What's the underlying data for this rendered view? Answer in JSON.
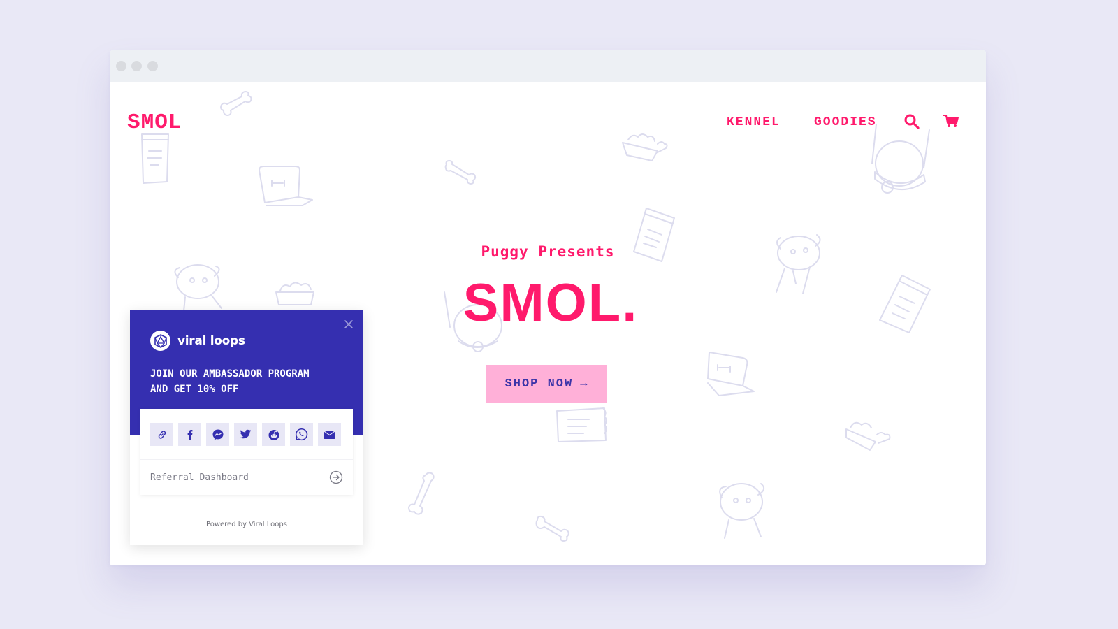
{
  "window": {
    "controls": [
      "close",
      "minimize",
      "maximize"
    ]
  },
  "site": {
    "logo": "SMOL",
    "nav": [
      {
        "label": "KENNEL"
      },
      {
        "label": "GOODIES"
      }
    ],
    "icons": {
      "search": "search-icon",
      "cart": "cart-icon"
    },
    "colors": {
      "brand": "#ff1a6c",
      "button_bg": "#ffb0d8",
      "button_text": "#3a33a8",
      "doodle": "#dcdcee"
    }
  },
  "hero": {
    "subtitle": "Puggy Presents",
    "title": "SMOL.",
    "cta_label": "SHOP NOW",
    "cta_arrow": "→"
  },
  "widget": {
    "brand_name": "viral loops",
    "headline_line1": "JOIN OUR AMBASSADOR PROGRAM",
    "headline_line2": "AND GET 10% OFF",
    "share_buttons": [
      {
        "name": "copy-link",
        "icon": "link-icon"
      },
      {
        "name": "facebook",
        "icon": "facebook-icon"
      },
      {
        "name": "messenger",
        "icon": "messenger-icon"
      },
      {
        "name": "twitter",
        "icon": "twitter-icon"
      },
      {
        "name": "reddit",
        "icon": "reddit-icon"
      },
      {
        "name": "whatsapp",
        "icon": "whatsapp-icon"
      },
      {
        "name": "email",
        "icon": "email-icon"
      }
    ],
    "dashboard_label": "Referral Dashboard",
    "powered_by": "Powered by Viral Loops",
    "colors": {
      "header": "#352fb0",
      "share_bg": "#e8e7f6",
      "share_icon": "#352fb0"
    }
  }
}
